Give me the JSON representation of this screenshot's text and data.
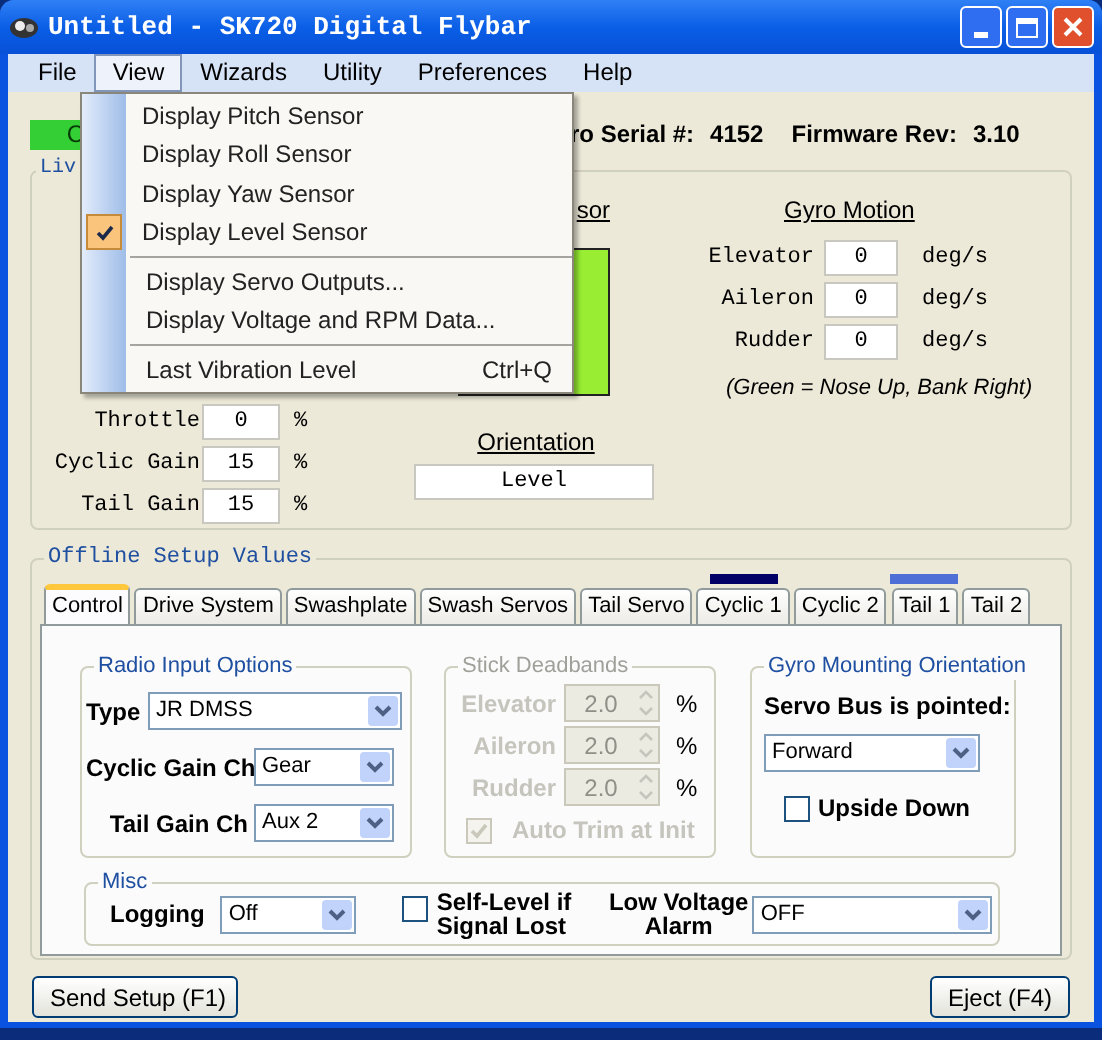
{
  "window": {
    "title": "Untitled - SK720 Digital Flybar"
  },
  "menu_bar": [
    {
      "label": "File",
      "selected": false
    },
    {
      "label": "View",
      "selected": true
    },
    {
      "label": "Wizards",
      "selected": false
    },
    {
      "label": "Utility",
      "selected": false
    },
    {
      "label": "Preferences",
      "selected": false
    },
    {
      "label": "Help",
      "selected": false
    }
  ],
  "view_menu": {
    "groups": [
      [
        {
          "label": "Display Pitch Sensor",
          "checked": false
        },
        {
          "label": "Display Roll Sensor",
          "checked": false
        },
        {
          "label": "Display Yaw Sensor",
          "checked": false
        },
        {
          "label": "Display Level Sensor",
          "checked": true
        }
      ],
      [
        {
          "label": "Display Servo Outputs...",
          "checked": false
        },
        {
          "label": "Display Voltage and RPM Data...",
          "checked": false
        }
      ],
      [
        {
          "label": "Last Vibration Level",
          "shortcut": "Ctrl+Q",
          "checked": false
        }
      ]
    ]
  },
  "status_indicator": {
    "text": "C"
  },
  "gyro_serial": {
    "label": "ro Serial #:",
    "value": "4152"
  },
  "firmware": {
    "label": "Firmware Rev:",
    "value": "3.10"
  },
  "live_group": {
    "label": "Liv",
    "inputs": [
      {
        "label": "Throttle",
        "value": "0",
        "unit": "%"
      },
      {
        "label": "Cyclic Gain",
        "value": "15",
        "unit": "%"
      },
      {
        "label": "Tail Gain",
        "value": "15",
        "unit": "%"
      }
    ],
    "sensor_title": "sor",
    "orientation": {
      "title": "Orientation",
      "value": "Level"
    },
    "gyro_motion": {
      "title": "Gyro Motion",
      "rows": [
        {
          "label": "Elevator",
          "value": "0",
          "unit": "deg/s"
        },
        {
          "label": "Aileron",
          "value": "0",
          "unit": "deg/s"
        },
        {
          "label": "Rudder",
          "value": "0",
          "unit": "deg/s"
        }
      ],
      "note": "(Green = Nose Up, Bank Right)"
    }
  },
  "offline_group": {
    "label": "Offline Setup Values",
    "tabs": [
      {
        "label": "Control",
        "selected": true
      },
      {
        "label": "Drive System",
        "selected": false
      },
      {
        "label": "Swashplate",
        "selected": false
      },
      {
        "label": "Swash Servos",
        "selected": false
      },
      {
        "label": "Tail Servo",
        "selected": false
      },
      {
        "label": "Cyclic 1",
        "selected": false,
        "color": "#000066"
      },
      {
        "label": "Cyclic 2",
        "selected": false
      },
      {
        "label": "Tail 1",
        "selected": false,
        "color": "#4d6fd6"
      },
      {
        "label": "Tail 2",
        "selected": false
      }
    ]
  },
  "radio_input": {
    "title": "Radio Input Options",
    "fields": [
      {
        "label": "Type",
        "value": "JR DMSS"
      },
      {
        "label": "Cyclic Gain Ch",
        "value": "Gear"
      },
      {
        "label": "Tail Gain Ch",
        "value": "Aux 2"
      }
    ]
  },
  "stick_deadbands": {
    "title": "Stick Deadbands",
    "disabled": true,
    "rows": [
      {
        "label": "Elevator",
        "value": "2.0",
        "unit": "%"
      },
      {
        "label": "Aileron",
        "value": "2.0",
        "unit": "%"
      },
      {
        "label": "Rudder",
        "value": "2.0",
        "unit": "%"
      }
    ],
    "auto_trim": {
      "label": "Auto Trim at Init",
      "checked": true
    }
  },
  "gyro_mounting": {
    "title": "Gyro Mounting Orientation",
    "prompt": "Servo Bus is pointed:",
    "direction": "Forward",
    "upside_down": {
      "label": "Upside Down",
      "checked": false
    }
  },
  "misc": {
    "title": "Misc",
    "logging": {
      "label": "Logging",
      "value": "Off"
    },
    "self_level": {
      "label": "Self-Level if Signal Lost",
      "checked": false
    },
    "low_voltage": {
      "label": "Low Voltage Alarm",
      "value": "OFF"
    }
  },
  "buttons": [
    {
      "label": "Send Setup (F1)"
    },
    {
      "label": "Eject (F4)"
    }
  ]
}
